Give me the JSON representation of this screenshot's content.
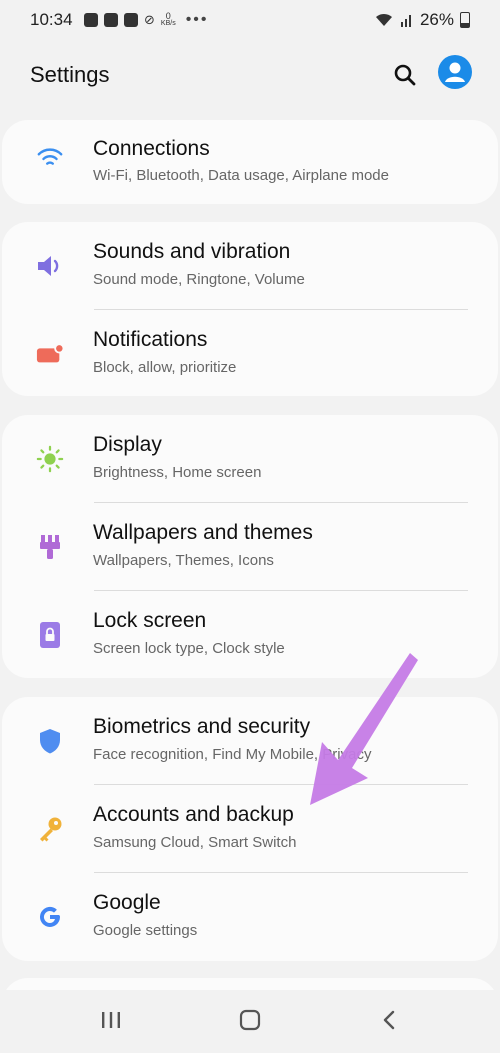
{
  "status": {
    "time": "10:34",
    "net_speed_value": "0",
    "net_speed_unit": "KB/s",
    "more": "•••",
    "battery": "26%"
  },
  "header": {
    "title": "Settings"
  },
  "groups": [
    {
      "items": [
        {
          "label": "Connections",
          "sub": "Wi-Fi, Bluetooth, Data usage, Airplane mode",
          "icon": "wifi-icon",
          "color": "#3b8ff0"
        }
      ]
    },
    {
      "items": [
        {
          "label": "Sounds and vibration",
          "sub": "Sound mode, Ringtone, Volume",
          "icon": "speaker-icon",
          "color": "#7f6fe0"
        },
        {
          "label": "Notifications",
          "sub": "Block, allow, prioritize",
          "icon": "notification-icon",
          "color": "#ee6b5a"
        }
      ]
    },
    {
      "items": [
        {
          "label": "Display",
          "sub": "Brightness, Home screen",
          "icon": "sun-icon",
          "color": "#8fd14f"
        },
        {
          "label": "Wallpapers and themes",
          "sub": "Wallpapers, Themes, Icons",
          "icon": "paintbrush-icon",
          "color": "#b06ad6"
        },
        {
          "label": "Lock screen",
          "sub": "Screen lock type, Clock style",
          "icon": "lock-icon",
          "color": "#9b7be6"
        }
      ]
    },
    {
      "items": [
        {
          "label": "Biometrics and security",
          "sub": "Face recognition, Find My Mobile, Privacy",
          "icon": "shield-icon",
          "color": "#4f8df0"
        },
        {
          "label": "Accounts and backup",
          "sub": "Samsung Cloud, Smart Switch",
          "icon": "key-icon",
          "color": "#f0b23a"
        },
        {
          "label": "Google",
          "sub": "Google settings",
          "icon": "google-icon",
          "color": "#4285f4"
        }
      ]
    }
  ],
  "annotation": {
    "arrow_color": "#c57be6"
  }
}
